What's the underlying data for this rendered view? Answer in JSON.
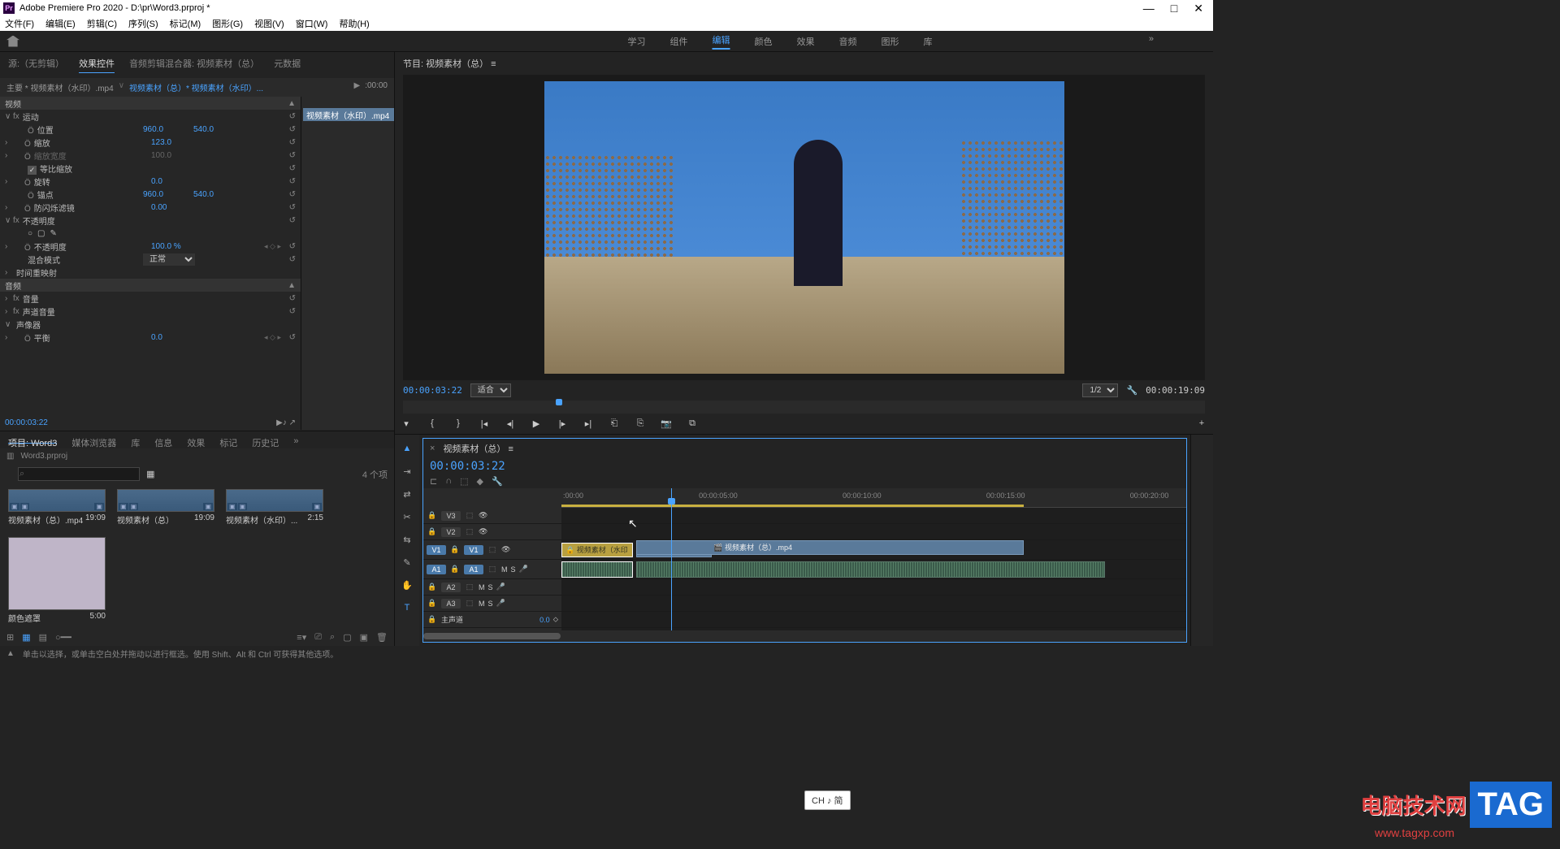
{
  "app": {
    "title": "Adobe Premiere Pro 2020 - D:\\pr\\Word3.prproj *",
    "icon_text": "Pr"
  },
  "menu": [
    "文件(F)",
    "编辑(E)",
    "剪辑(C)",
    "序列(S)",
    "标记(M)",
    "图形(G)",
    "视图(V)",
    "窗口(W)",
    "帮助(H)"
  ],
  "workspaces": {
    "items": [
      "学习",
      "组件",
      "编辑",
      "颜色",
      "效果",
      "音频",
      "图形",
      "库"
    ],
    "active": "编辑",
    "overflow": "»"
  },
  "source_tabs": {
    "items": [
      "源:（无剪辑）",
      "效果控件",
      "音频剪辑混合器: 视频素材（总）",
      "元数据"
    ],
    "active": "效果控件"
  },
  "effect_controls": {
    "master_label": "主要 * 视频素材（水印）.mp4",
    "clip_label": "视频素材（总）* 视频素材（水印）...",
    "tc_start": ":00:00",
    "timeline_clip": "视频素材（水印）.mp4",
    "tc": "00:00:03:22",
    "sections": {
      "video": "视频",
      "motion": "运动",
      "position": "位置",
      "pos_x": "960.0",
      "pos_y": "540.0",
      "scale": "缩放",
      "scale_v": "123.0",
      "scale_w": "缩放宽度",
      "scale_w_v": "100.0",
      "uniform": "等比缩放",
      "rotation": "旋转",
      "rotation_v": "0.0",
      "anchor": "锚点",
      "anchor_x": "960.0",
      "anchor_y": "540.0",
      "flicker": "防闪烁滤镜",
      "flicker_v": "0.00",
      "opacity": "不透明度",
      "opacity_prop": "不透明度",
      "opacity_v": "100.0 %",
      "blend": "混合模式",
      "blend_v": "正常",
      "time_remap": "时间重映射",
      "audio": "音频",
      "volume": "音量",
      "channel_vol": "声道音量",
      "panner": "声像器",
      "balance": "平衡",
      "balance_v": "0.0"
    }
  },
  "project": {
    "tabs": [
      "项目: Word3",
      "媒体浏览器",
      "库",
      "信息",
      "效果",
      "标记",
      "历史记"
    ],
    "active": "项目: Word3",
    "file": "Word3.prproj",
    "search_placeholder": "",
    "count": "4 个项",
    "items": [
      {
        "name": "视频素材（总）.mp4",
        "dur": "19:09"
      },
      {
        "name": "视频素材（总）",
        "dur": "19:09"
      },
      {
        "name": "视频素材（水印）...",
        "dur": "2:15"
      },
      {
        "name": "颜色遮罩",
        "dur": "5:00"
      }
    ]
  },
  "program": {
    "title": "节目: 视频素材（总） ≡",
    "tc": "00:00:03:22",
    "fit": "适合",
    "zoom": "1/2",
    "duration": "00:00:19:09"
  },
  "timeline": {
    "seq_name": "视频素材（总） ≡",
    "tc": "00:00:03:22",
    "ruler": [
      ":00:00",
      "00:00:05:00",
      "00:00:10:00",
      "00:00:15:00",
      "00:00:20:00"
    ],
    "tracks": {
      "v3": "V3",
      "v2": "V2",
      "v1": "V1",
      "v1src": "V1",
      "a1": "A1",
      "a1src": "A1",
      "a2": "A2",
      "a3": "A3",
      "master": "主声道",
      "master_v": "0.0"
    },
    "clips": {
      "v1a": "视频素材（水印",
      "v1b": "视频素材（总）",
      "v1c": "视频素材（总）.mp4"
    }
  },
  "status": {
    "hint": "单击以选择，或单击空白处并拖动以进行框选。使用 Shift、Alt 和 Ctrl 可获得其他选项。"
  },
  "ime": "CH ♪ 简",
  "watermark": {
    "txt": "电脑技术网",
    "sub": "www.tagxp.com",
    "tag": "TAG"
  }
}
